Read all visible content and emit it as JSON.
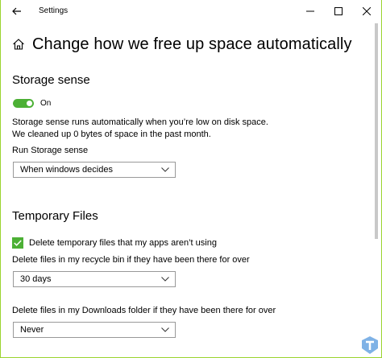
{
  "window": {
    "title": "Settings",
    "controls": {
      "minimize": "minimize-icon",
      "maximize": "maximize-icon",
      "close": "close-icon"
    }
  },
  "page": {
    "title": "Change how we free up space automatically"
  },
  "storage_sense": {
    "heading": "Storage sense",
    "toggle_label": "On",
    "toggle_on": true,
    "description_line1": "Storage sense runs automatically when you’re low on disk space.",
    "description_line2": "We cleaned up 0 bytes of space in the past month.",
    "run_label": "Run Storage sense",
    "run_value": "When windows decides"
  },
  "temporary_files": {
    "heading": "Temporary Files",
    "delete_temp_label": "Delete temporary files that my apps aren’t using",
    "delete_temp_checked": true,
    "recycle_label": "Delete files in my recycle bin if they have been there for over",
    "recycle_value": "30 days",
    "downloads_label": "Delete files in my Downloads folder if they have been there for over",
    "downloads_value": "Never"
  },
  "colors": {
    "accent": "#4cb035",
    "border_frame": "#9bd42f"
  }
}
